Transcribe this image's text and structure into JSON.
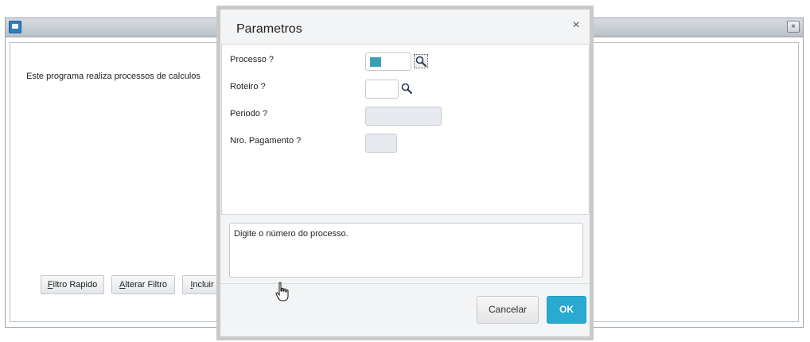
{
  "background_window": {
    "close_glyph": "×",
    "description": "Este programa realiza processos de calculos",
    "buttons": {
      "filtro_rapido": "Filtro Rapido",
      "alterar_filtro": "Alterar Filtro",
      "incluir": "Incluir"
    }
  },
  "dialog": {
    "title": "Parametros",
    "close_glyph": "×",
    "fields": {
      "processo": {
        "label": "Processo ?",
        "value": ""
      },
      "roteiro": {
        "label": "Roteiro ?",
        "value": ""
      },
      "periodo": {
        "label": "Periodo ?",
        "value": ""
      },
      "nro_pagamento": {
        "label": "Nro. Pagamento ?",
        "value": ""
      }
    },
    "help_text": "Digite o número do processo.",
    "buttons": {
      "cancel": "Cancelar",
      "ok": "OK"
    }
  },
  "colors": {
    "ok_button": "#2aa9d1",
    "processo_marker": "#3d9fb6",
    "dialog_border": "#c9c9c9"
  },
  "icons": [
    "app-window-icon",
    "close-icon",
    "search-icon",
    "hand-cursor-icon"
  ]
}
